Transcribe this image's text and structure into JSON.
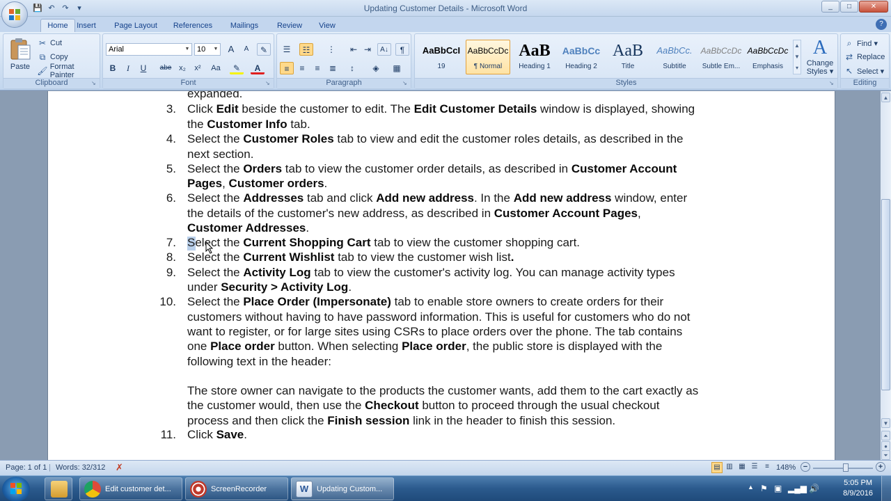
{
  "window": {
    "title": "Updating Customer Details - Microsoft Word",
    "minimize": "_",
    "maximize": "□",
    "close": "✕"
  },
  "quick_access": {
    "save": "💾",
    "undo": "↶",
    "redo": "↷",
    "customize": "▾"
  },
  "tabs": [
    {
      "label": "Home",
      "active": true
    },
    {
      "label": "Insert"
    },
    {
      "label": "Page Layout"
    },
    {
      "label": "References"
    },
    {
      "label": "Mailings"
    },
    {
      "label": "Review"
    },
    {
      "label": "View"
    }
  ],
  "ribbon": {
    "clipboard": {
      "label": "Clipboard",
      "paste": "Paste",
      "cut": "Cut",
      "copy": "Copy",
      "format_painter": "Format Painter"
    },
    "font": {
      "label": "Font",
      "font_name": "Arial",
      "font_size": "10",
      "grow": "A",
      "shrink": "A",
      "bold": "B",
      "italic": "I",
      "underline": "U",
      "strike": "abe",
      "subscript": "x₂",
      "superscript": "x²",
      "change_case": "Aa",
      "font_color": "A"
    },
    "paragraph": {
      "label": "Paragraph",
      "show_marks": "¶",
      "sort": "A↓"
    },
    "styles": {
      "label": "Styles",
      "items": [
        {
          "preview": "AaBbCcI",
          "name": "19",
          "preview_weight": "bold",
          "preview_size": "13px",
          "preview_color": "#000000",
          "active": false
        },
        {
          "preview": "AaBbCcDc",
          "name": "¶ Normal",
          "preview_weight": "normal",
          "preview_size": "12px",
          "preview_color": "#000000",
          "active": true
        },
        {
          "preview": "AaB",
          "name": "Heading 1",
          "preview_weight": "bold",
          "preview_size": "24px",
          "preview_color": "#000000",
          "active": false
        },
        {
          "preview": "AaBbCc",
          "name": "Heading 2",
          "preview_weight": "bold",
          "preview_size": "14px",
          "preview_color": "#4f81bd",
          "active": false
        },
        {
          "preview": "AaB",
          "name": "Title",
          "preview_weight": "normal",
          "preview_size": "24px",
          "preview_color": "#17365d",
          "active": false
        },
        {
          "preview": "AaBbCc.",
          "name": "Subtitle",
          "preview_weight": "normal",
          "preview_size": "13px",
          "preview_color": "#4f81bd",
          "active": false
        },
        {
          "preview": "AaBbCcDc",
          "name": "Subtle Em...",
          "preview_weight": "normal",
          "preview_size": "12px",
          "preview_color": "#808080",
          "active": false
        },
        {
          "preview": "AaBbCcDc",
          "name": "Emphasis",
          "preview_weight": "normal",
          "preview_size": "12px",
          "preview_color": "#000000",
          "active": false
        }
      ],
      "change_styles_1": "Change",
      "change_styles_2": "Styles ▾"
    },
    "editing": {
      "label": "Editing",
      "find": "Find ▾",
      "replace": "Replace",
      "select": "Select ▾"
    }
  },
  "document": {
    "lines": [
      {
        "segments": [
          {
            "t": "expanded.",
            "b": false
          }
        ]
      },
      {
        "num": "3.",
        "segments": [
          {
            "t": "Click ",
            "b": false
          },
          {
            "t": "Edit",
            "b": true
          },
          {
            "t": " beside the customer to edit. The ",
            "b": false
          },
          {
            "t": "Edit Customer Details",
            "b": true
          },
          {
            "t": " window is displayed, showing",
            "b": false
          }
        ]
      },
      {
        "segments": [
          {
            "t": "the ",
            "b": false
          },
          {
            "t": "Customer Info",
            "b": true
          },
          {
            "t": " tab.",
            "b": false
          }
        ]
      },
      {
        "num": "4.",
        "segments": [
          {
            "t": "Select the ",
            "b": false
          },
          {
            "t": "Customer Roles",
            "b": true
          },
          {
            "t": " tab to view and edit the customer roles details, as described in the",
            "b": false
          }
        ]
      },
      {
        "segments": [
          {
            "t": "next section.",
            "b": false
          }
        ]
      },
      {
        "num": "5.",
        "segments": [
          {
            "t": "Select the ",
            "b": false
          },
          {
            "t": "Orders",
            "b": true
          },
          {
            "t": " tab to view the customer order details, as described in ",
            "b": false
          },
          {
            "t": "Customer Account",
            "b": true
          }
        ]
      },
      {
        "segments": [
          {
            "t": "Pages",
            "b": true
          },
          {
            "t": ", ",
            "b": false
          },
          {
            "t": "Customer orders",
            "b": true
          },
          {
            "t": ".",
            "b": false
          }
        ]
      },
      {
        "num": "6.",
        "segments": [
          {
            "t": "Select the ",
            "b": false
          },
          {
            "t": "Addresses",
            "b": true
          },
          {
            "t": " tab and click ",
            "b": false
          },
          {
            "t": "Add new address",
            "b": true
          },
          {
            "t": ". In the ",
            "b": false
          },
          {
            "t": "Add new address",
            "b": true
          },
          {
            "t": " window, enter",
            "b": false
          }
        ]
      },
      {
        "segments": [
          {
            "t": "the details of the customer's new address, as described in ",
            "b": false
          },
          {
            "t": "Customer Account Pages",
            "b": true
          },
          {
            "t": ",",
            "b": false
          }
        ]
      },
      {
        "segments": [
          {
            "t": "Customer Addresses",
            "b": true
          },
          {
            "t": ".",
            "b": false
          }
        ]
      },
      {
        "num": "7.",
        "segments": [
          {
            "t": "Select the ",
            "b": false
          },
          {
            "t": "Current Shopping Cart",
            "b": true
          },
          {
            "t": " tab to view the customer shopping cart.",
            "b": false
          }
        ]
      },
      {
        "num": "8.",
        "segments": [
          {
            "t": "Select the ",
            "b": false
          },
          {
            "t": "Current Wishlist",
            "b": true
          },
          {
            "t": " tab to view the customer wish list",
            "b": false
          },
          {
            "t": ".",
            "b": true
          }
        ]
      },
      {
        "num": "9.",
        "segments": [
          {
            "t": "Select the ",
            "b": false
          },
          {
            "t": "Activity Log",
            "b": true
          },
          {
            "t": " tab to view the customer's activity log. You can manage activity types",
            "b": false
          }
        ]
      },
      {
        "segments": [
          {
            "t": "under ",
            "b": false
          },
          {
            "t": "Security > Activity Log",
            "b": true
          },
          {
            "t": ".",
            "b": false
          }
        ]
      },
      {
        "num": "10.",
        "segments": [
          {
            "t": "Select the ",
            "b": false
          },
          {
            "t": "Place Order (Impersonate)",
            "b": true
          },
          {
            "t": " tab to enable store owners to create orders for their",
            "b": false
          }
        ]
      },
      {
        "segments": [
          {
            "t": "customers without having to have password information. This is useful for customers who do not",
            "b": false
          }
        ]
      },
      {
        "segments": [
          {
            "t": "want to register, or for large sites using CSRs to place orders over the phone. The tab contains",
            "b": false
          }
        ]
      },
      {
        "segments": [
          {
            "t": "one ",
            "b": false
          },
          {
            "t": "Place order",
            "b": true
          },
          {
            "t": " button. When selecting ",
            "b": false
          },
          {
            "t": "Place order",
            "b": true
          },
          {
            "t": ", the public store is displayed with the",
            "b": false
          }
        ]
      },
      {
        "segments": [
          {
            "t": "following text in the header:",
            "b": false
          }
        ]
      },
      {
        "segments": []
      },
      {
        "segments": [
          {
            "t": "The store owner can navigate to the products the customer wants, add them to the cart exactly as",
            "b": false
          }
        ]
      },
      {
        "segments": [
          {
            "t": "the customer would, then use the ",
            "b": false
          },
          {
            "t": "Checkout",
            "b": true
          },
          {
            "t": " button to proceed through the usual checkout",
            "b": false
          }
        ]
      },
      {
        "segments": [
          {
            "t": "process and then click the ",
            "b": false
          },
          {
            "t": "Finish session",
            "b": true
          },
          {
            "t": " link in the header to finish this session.",
            "b": false
          }
        ]
      },
      {
        "num": "11.",
        "segments": [
          {
            "t": "Click ",
            "b": false
          },
          {
            "t": "Save",
            "b": true
          },
          {
            "t": ".",
            "b": false
          }
        ]
      }
    ]
  },
  "statusbar": {
    "page": "Page: 1 of 1",
    "words": "Words: 32/312",
    "zoom": "148%",
    "zoom_minus": "−",
    "zoom_plus": "+"
  },
  "taskbar": {
    "apps": [
      {
        "label": "Edit customer det...",
        "icon_color": "#dd4b39"
      },
      {
        "label": "ScreenRecorder",
        "icon_color": "#c0392b"
      },
      {
        "label": "Updating Custom...",
        "icon_color": "#2b5797",
        "active": true
      }
    ],
    "time": "5:05 PM",
    "date": "8/9/2016"
  }
}
